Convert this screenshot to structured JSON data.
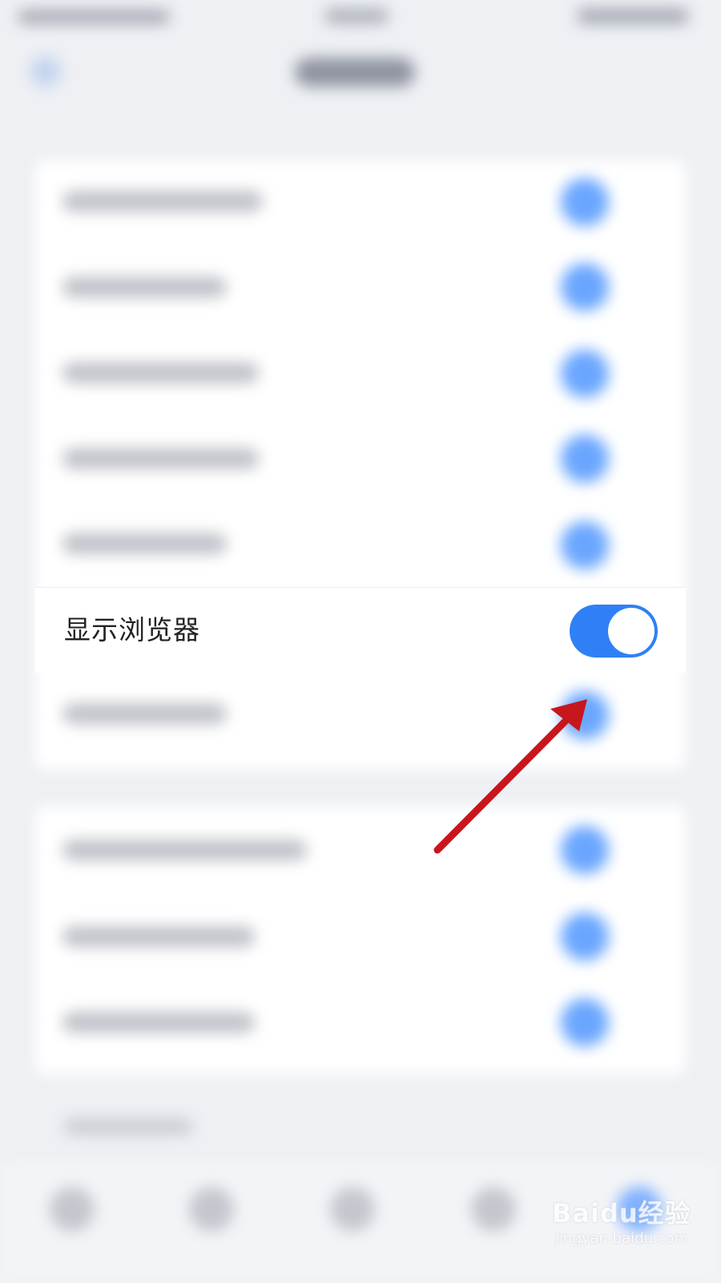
{
  "highlight_row": {
    "label": "显示浏览器",
    "toggle_state": "on"
  },
  "colors": {
    "toggle_on": "#2f80f6",
    "annotation_arrow": "#c8161d"
  },
  "watermark": {
    "brand": "Baidu经验",
    "url": "jingyan.baidu.com"
  }
}
